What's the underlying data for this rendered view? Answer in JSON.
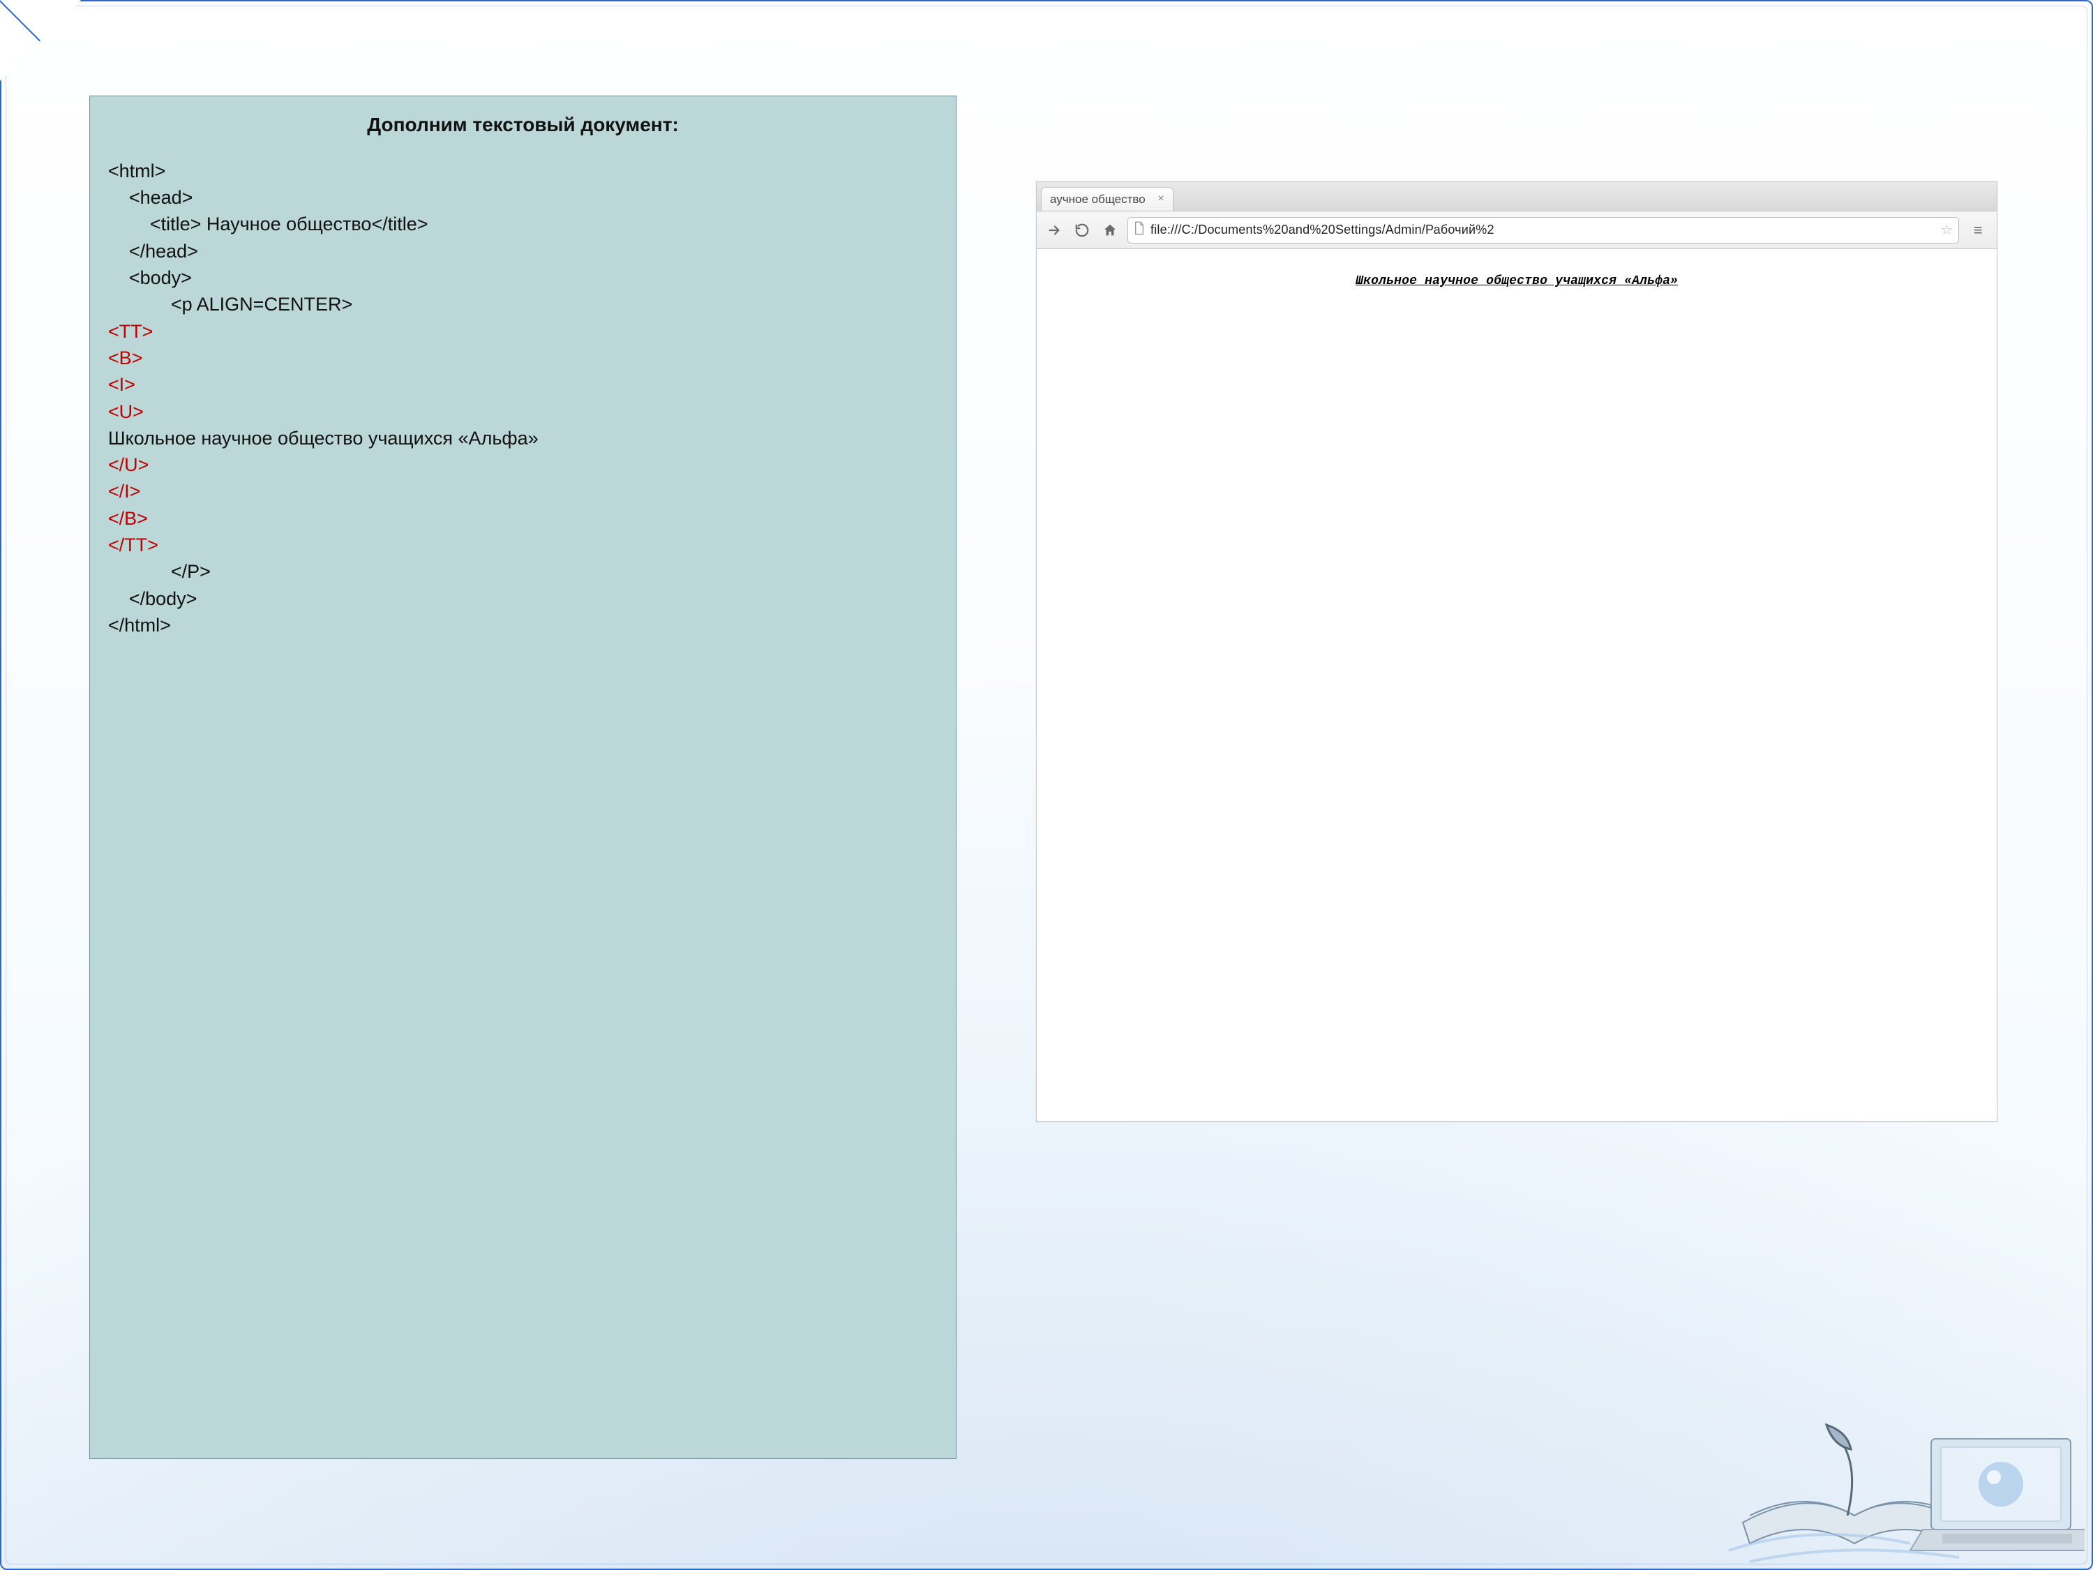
{
  "left": {
    "title": "Дополним текстовый документ:",
    "lines": [
      {
        "t": "<html>",
        "i": 0,
        "c": "black"
      },
      {
        "t": "<head>",
        "i": 1,
        "c": "black"
      },
      {
        "t": "<title> Научное общество</title>",
        "i": 2,
        "c": "black"
      },
      {
        "t": "</head>",
        "i": 1,
        "c": "black"
      },
      {
        "t": "<body>",
        "i": 1,
        "c": "black"
      },
      {
        "t": "<p ALIGN=CENTER>",
        "i": 3,
        "c": "black"
      },
      {
        "t": "<TT>",
        "i": 0,
        "c": "red"
      },
      {
        "t": "<B>",
        "i": 0,
        "c": "red"
      },
      {
        "t": "<I>",
        "i": 0,
        "c": "red"
      },
      {
        "t": "<U>",
        "i": 0,
        "c": "red"
      },
      {
        "t": "Школьное научное общество учащихся «Альфа»",
        "i": 0,
        "c": "black"
      },
      {
        "t": "</U>",
        "i": 0,
        "c": "red"
      },
      {
        "t": "</I>",
        "i": 0,
        "c": "red"
      },
      {
        "t": "</B>",
        "i": 0,
        "c": "red"
      },
      {
        "t": "</TT>",
        "i": 0,
        "c": "red"
      },
      {
        "t": "</P>",
        "i": 3,
        "c": "black"
      },
      {
        "t": "</body>",
        "i": 1,
        "c": "black"
      },
      {
        "t": "</html>",
        "i": 0,
        "c": "black"
      }
    ]
  },
  "browser": {
    "tab_title": "аучное общество",
    "url": "file:///C:/Documents%20and%20Settings/Admin/Рабочий%2",
    "rendered_text": "Школьное научное общество учащихся «Альфа»",
    "close_glyph": "×",
    "star_glyph": "☆",
    "menu_glyph": "≡"
  }
}
